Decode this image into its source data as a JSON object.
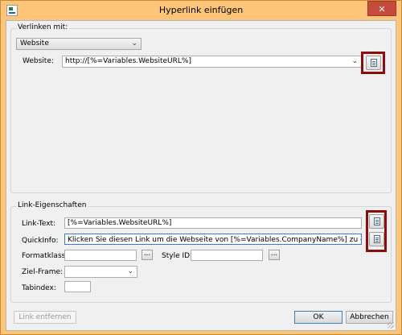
{
  "window": {
    "title": "Hyperlink einfügen",
    "close_symbol": "✕"
  },
  "link_with": {
    "group_label": "Verlinken mit:",
    "type_value": "Website",
    "website_label": "Website:",
    "website_value": "http://[%=Variables.WebsiteURL%]"
  },
  "link_props": {
    "group_label": "Link-Eigenschaften",
    "link_text_label": "Link-Text:",
    "link_text_value": "[%=Variables.WebsiteURL%]",
    "quickinfo_label": "QuickInfo:",
    "quickinfo_value": "Klicken Sie diesen Link um die Webseite von [%=Variables.CompanyName%] zu öffnen.",
    "format_class_label": "Formatklasse:",
    "format_class_value": "",
    "style_id_label": "Style ID:",
    "style_id_value": "",
    "browse_symbol": "...",
    "target_frame_label": "Ziel-Frame:",
    "target_frame_value": "",
    "tabindex_label": "Tabindex:",
    "tabindex_value": ""
  },
  "footer": {
    "remove_link": "Link entfernen",
    "ok": "OK",
    "cancel": "Abbrechen"
  },
  "colors": {
    "titlebar": "#fdc57a",
    "highlight_frame": "#8b0d0d",
    "close_button": "#c74b3c"
  }
}
